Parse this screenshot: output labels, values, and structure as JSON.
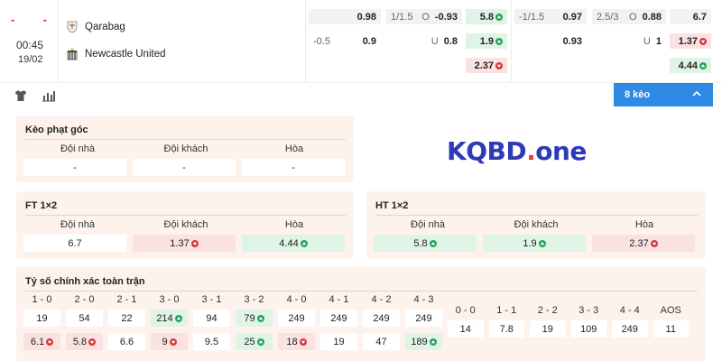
{
  "match": {
    "score_home": "-",
    "score_away": "-",
    "time": "00:45",
    "date": "19/02",
    "home_team": "Qarabag",
    "away_team": "Newcastle United",
    "odds": {
      "ft_hdp": {
        "row1": {
          "label": "",
          "value": "0.98"
        },
        "row2": {
          "label": "-0.5",
          "value": "0.9"
        }
      },
      "ft_ou": {
        "row1": {
          "label": "1/1.5",
          "side": "O",
          "value": "-0.93"
        },
        "row2": {
          "label": "",
          "side": "U",
          "value": "0.8"
        }
      },
      "ft_1x2": [
        "5.8",
        "1.9",
        "2.37"
      ],
      "ht_hdp": {
        "row1": {
          "label": "-1/1.5",
          "value": "0.97"
        },
        "row2": {
          "label": "",
          "value": "0.93"
        }
      },
      "ht_ou": {
        "row1": {
          "label": "2.5/3",
          "side": "O",
          "value": "0.88"
        },
        "row2": {
          "label": "",
          "side": "U",
          "value": "1"
        }
      },
      "ht_1x2": [
        "6.7",
        "1.37",
        "4.44"
      ]
    }
  },
  "toolbar": {
    "more_label": "8 kèo"
  },
  "corner": {
    "title": "Kèo phạt góc",
    "cols": [
      "Đội nhà",
      "Đội khách",
      "Hòa"
    ],
    "values": [
      "-",
      "-",
      "-"
    ]
  },
  "brand": {
    "name": "KQBD",
    "dot": ".",
    "suffix": "one"
  },
  "ft12": {
    "title": "FT 1×2",
    "cols": [
      "Đội nhà",
      "Đội khách",
      "Hòa"
    ],
    "values": [
      "6.7",
      "1.37",
      "4.44"
    ]
  },
  "ht12": {
    "title": "HT 1×2",
    "cols": [
      "Đội nhà",
      "Đội khách",
      "Hòa"
    ],
    "values": [
      "5.8",
      "1.9",
      "2.37"
    ]
  },
  "correct_score": {
    "title": "Tỷ số chính xác toàn trận",
    "home_cols": [
      "1 - 0",
      "2 - 0",
      "2 - 1",
      "3 - 0",
      "3 - 1",
      "3 - 2",
      "4 - 0",
      "4 - 1",
      "4 - 2",
      "4 - 3"
    ],
    "home_row1": [
      "19",
      "54",
      "22",
      "214",
      "94",
      "79",
      "249",
      "249",
      "249",
      "249"
    ],
    "home_row2": [
      "6.1",
      "5.8",
      "6.6",
      "9",
      "9.5",
      "25",
      "18",
      "19",
      "47",
      "189"
    ],
    "draw_cols": [
      "0 - 0",
      "1 - 1",
      "2 - 2",
      "3 - 3",
      "4 - 4",
      "AOS"
    ],
    "draw_row": [
      "14",
      "7.8",
      "19",
      "109",
      "249",
      "11"
    ]
  },
  "colors": {
    "accent_blue": "#2f8ae5",
    "up_green": "#27a35a",
    "down_red": "#d23b3b",
    "panel_bg": "#fdf3ec",
    "brand_blue": "#2d3bb6"
  }
}
